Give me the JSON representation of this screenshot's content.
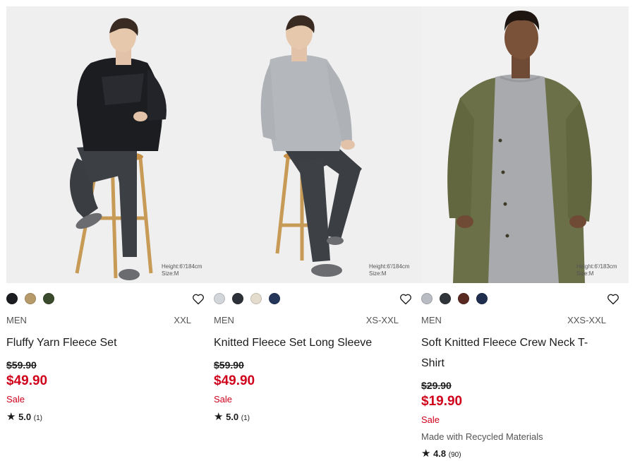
{
  "products": [
    {
      "photo_note_line1": "Height:6'/184cm",
      "photo_note_line2": "Size:M",
      "swatches": [
        "#1b1c1f",
        "#b69a6a",
        "#3a4a2c"
      ],
      "gender": "MEN",
      "sizes": "XXL",
      "name": "Fluffy Yarn Fleece Set",
      "original_price": "$59.90",
      "sale_price": "$49.90",
      "flag": "Sale",
      "rating_star": "★",
      "rating": "5.0",
      "reviews": "(1)"
    },
    {
      "photo_note_line1": "Height:6'/184cm",
      "photo_note_line2": "Size:M",
      "swatches": [
        "#d2d6da",
        "#2c3038",
        "#e4dccd",
        "#24365a"
      ],
      "gender": "MEN",
      "sizes": "XS-XXL",
      "name": "Knitted Fleece Set Long Sleeve",
      "original_price": "$59.90",
      "sale_price": "$49.90",
      "flag": "Sale",
      "rating_star": "★",
      "rating": "5.0",
      "reviews": "(1)"
    },
    {
      "photo_note_line1": "Height:6'/183cm",
      "photo_note_line2": "Size:M",
      "swatches": [
        "#b9bcc2",
        "#30343b",
        "#5a2a22",
        "#1f2e4f"
      ],
      "gender": "MEN",
      "sizes": "XXS-XXL",
      "name": "Soft Knitted Fleece Crew Neck T-Shirt",
      "original_price": "$29.90",
      "sale_price": "$19.90",
      "flag": "Sale",
      "note": "Made with Recycled Materials",
      "rating_star": "★",
      "rating": "4.8",
      "reviews": "(90)"
    }
  ],
  "colors": {
    "sale_red": "#d0021b",
    "text": "#1b1b1b",
    "muted": "#555555"
  },
  "icons": {
    "favorite": "heart-outline-icon",
    "rating": "star-icon"
  }
}
